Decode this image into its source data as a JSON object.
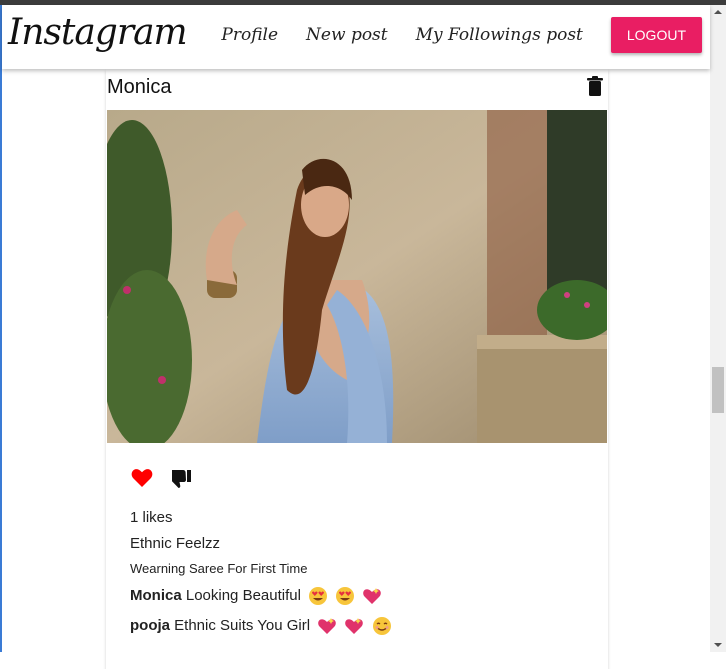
{
  "navbar": {
    "brand": "Instagram",
    "links": [
      "Profile",
      "New post",
      "My Followings post"
    ],
    "logout": "LOGOUT"
  },
  "post": {
    "author": "Monica",
    "likes": "1 likes",
    "title": "Ethnic Feelzz",
    "body": "Wearning Saree For First Time",
    "comments": [
      {
        "user": "Monica",
        "text": "Looking Beautiful",
        "emojis": [
          "heart-eyes",
          "heart-eyes",
          "sparkling-heart"
        ]
      },
      {
        "user": "pooja",
        "text": "Ethnic Suits You Girl",
        "emojis": [
          "sparkling-heart",
          "sparkling-heart",
          "smiling-face"
        ]
      }
    ]
  },
  "colors": {
    "accent": "#e91e63",
    "like": "#ff0000"
  }
}
